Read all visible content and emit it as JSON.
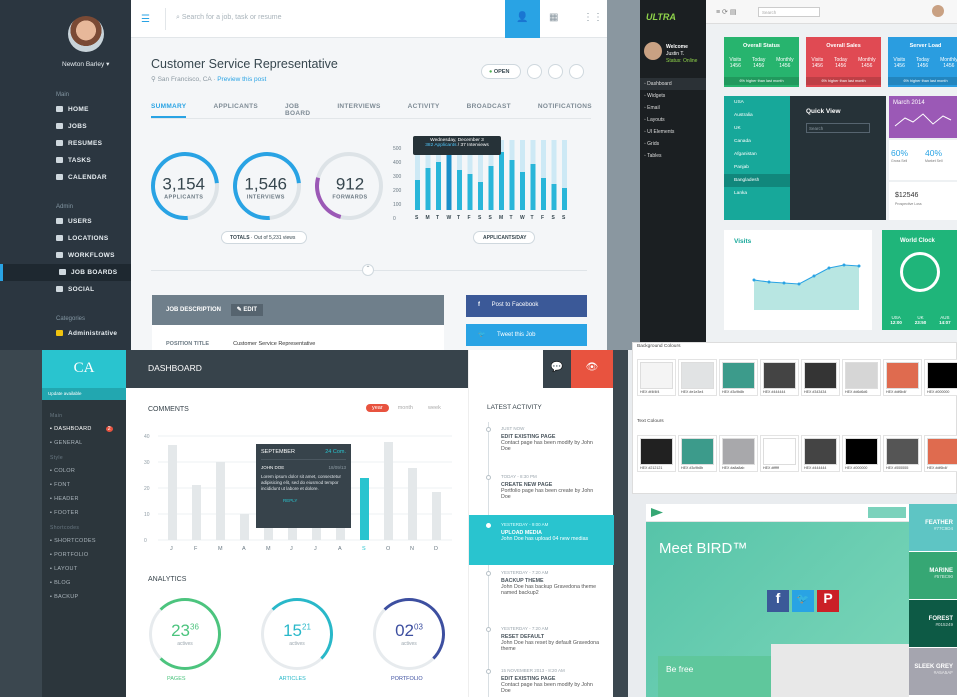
{
  "panel_a": {
    "user_name": "Newton Barley",
    "search_placeholder": "Search for a job, task or resume",
    "nav_main_header": "Main",
    "nav_main": [
      "HOME",
      "JOBS",
      "RESUMES",
      "TASKS",
      "CALENDAR"
    ],
    "nav_admin_header": "Admin",
    "nav_admin": [
      "USERS",
      "LOCATIONS",
      "WORKFLOWS",
      "JOB BOARDS",
      "SOCIAL"
    ],
    "nav_categories_header": "Categories",
    "nav_categories_first": "Administrative",
    "job_title": "Customer Service Representative",
    "location": "San Francisco, CA",
    "preview_link": "Preview this post",
    "status_label": "OPEN",
    "tabs": [
      "SUMMARY",
      "APPLICANTS",
      "JOB BOARD",
      "INTERVIEWS",
      "ACTIVITY",
      "BROADCAST",
      "NOTIFICATIONS"
    ],
    "stats": [
      {
        "value": "3,154",
        "label": "APPLICANTS"
      },
      {
        "value": "1,546",
        "label": "INTERVIEWS"
      },
      {
        "value": "912",
        "label": "FORWARDS"
      }
    ],
    "totals_label": "TOTALS",
    "totals_sub": "Out of 5,231 views",
    "chart_pill": "APPLICANTS/DAY",
    "tooltip_title": "Wednesday, December 3",
    "tooltip_apps": "382 Applicants",
    "tooltip_interviews": "37 Interviews",
    "job_desc_label": "JOB DESCRIPTION",
    "edit_label": "EDIT",
    "position_title_label": "POSITION TITLE",
    "position_title_value": "Customer Service Representative",
    "facebook_label": "Post to Facebook",
    "twitter_label": "Tweet this Job",
    "accent": "#29a3e4"
  },
  "panel_b": {
    "brand": "ULTRA",
    "search_placeholder": "Search",
    "welcome": "Welcome",
    "user": "Justin T.",
    "user_status": "Status: Online",
    "nav": [
      "Dashboard",
      "Widgets",
      "Email",
      "Layouts",
      "UI Elements",
      "Grids",
      "Tables"
    ],
    "tiles": [
      {
        "title": "Overall Status",
        "color": "#27b46e"
      },
      {
        "title": "Overall Sales",
        "color": "#e04a53"
      },
      {
        "title": "Server Load",
        "color": "#2a9de0"
      }
    ],
    "tile_cols": [
      "Visits",
      "Today",
      "Monthly"
    ],
    "tile_val": "1456",
    "tile_foot": "6% higher than last month",
    "countries": [
      "USA",
      "Australia",
      "UK",
      "Canada",
      "Afganistan",
      "Panjab",
      "Bangladesh",
      "Lanka"
    ],
    "quick_view": "Quick View",
    "quick_search": "Search",
    "month_label": "March 2014",
    "pct1": "60%",
    "pct1_label": "Gross Sell",
    "pct2": "40%",
    "pct2_label": "Market Sell",
    "amount": "$12546",
    "amount_label": "Prospective Loss",
    "visits_title": "Visits",
    "world_clock": "World Clock",
    "clocks": [
      {
        "city": "USA",
        "time": "12:00"
      },
      {
        "city": "UK",
        "time": "23:50"
      },
      {
        "city": "AUS",
        "time": "14:07"
      }
    ]
  },
  "panel_c": {
    "logo": "CA",
    "update": "Update available",
    "page_title": "DASHBOARD",
    "nav_sections": [
      {
        "header": "Main",
        "items": [
          "DASHBOARD",
          "GENERAL"
        ]
      },
      {
        "header": "Style",
        "items": [
          "COLOR",
          "FONT",
          "HEADER",
          "FOOTER"
        ]
      },
      {
        "header": "Shortcodes",
        "items": [
          "SHORTCODES",
          "PORTFOLIO",
          "LAYOUT",
          "BLOG",
          "BACKUP"
        ]
      }
    ],
    "dashboard_badge": "2",
    "comments_title": "COMMENTS",
    "periods": [
      "year",
      "month",
      "week"
    ],
    "months": [
      "J",
      "F",
      "M",
      "A",
      "M",
      "J",
      "J",
      "A",
      "S",
      "O",
      "N",
      "D"
    ],
    "y_ticks": [
      "40",
      "30",
      "20",
      "10",
      "0"
    ],
    "tooltip_month": "SEPTEMBER",
    "tooltip_count": "24 Com.",
    "tooltip_author": "JOHN DOE",
    "tooltip_date": "18/09/13",
    "tooltip_text": "Lorem ipsum dolor sit amet, consectetur adipisicing elit, sed do eiusmod tempor incididunt ut labore et dolore.",
    "tooltip_reply": "REPLY",
    "analytics_title": "ANALYTICS",
    "rings": [
      {
        "value": "23",
        "total": "36",
        "unit": "actives",
        "label": "PAGES",
        "color": "#4cc47e"
      },
      {
        "value": "15",
        "total": "21",
        "unit": "actives",
        "label": "ARTICLES",
        "color": "#29b8c9"
      },
      {
        "value": "02",
        "total": "03",
        "unit": "actives",
        "label": "PORTFOLIO",
        "color": "#3d4fa0"
      }
    ],
    "activity_title": "LATEST ACTIVITY",
    "events": [
      {
        "time": "JUST NOW",
        "title": "EDIT EXISTING PAGE",
        "text": "Contact page has been modify by John Doe"
      },
      {
        "time": "TODAY - 8:30 PM",
        "title": "CREATE NEW PAGE",
        "text": "Portfolio page has been create by John Doe"
      },
      {
        "time": "YESTERDAY - 9:00 AM",
        "title": "UPLOAD MEDIA",
        "text": "John Doe has upload 04 new medias"
      },
      {
        "time": "YESTERDAY - 7:20 AM",
        "title": "BACKUP THEME",
        "text": "John Doe has backup Gravedona theme named backup2"
      },
      {
        "time": "YESTERDAY - 7:20 AM",
        "title": "RESET DEFAULT",
        "text": "John Doe has reset by default Gravedona theme"
      },
      {
        "time": "15 NOVEMBER 2013 - 8:20 AM",
        "title": "EDIT EXISTING PAGE",
        "text": "Contact page has been modify by John Doe"
      }
    ],
    "accent": "#29c4cf",
    "red": "#e8533f"
  },
  "panel_d": {
    "bg_title": "Background Colours",
    "text_title": "Text Colours",
    "bg_swatches": [
      {
        "hex": "#f4f4f4",
        "label": "HEX #f4f4f4"
      },
      {
        "hex": "#e1e3e4",
        "label": "HEX #e1e3e4"
      },
      {
        "hex": "#3c9b8b",
        "label": "HEX #3c9b8b"
      },
      {
        "hex": "#444444",
        "label": "HEX #444444"
      },
      {
        "hex": "#343434",
        "label": "HEX #343434"
      },
      {
        "hex": "#d6d6d6",
        "label": "HEX #d6d6d6"
      },
      {
        "hex": "#df6b4f",
        "label": "HEX #df6b4f"
      },
      {
        "hex": "#000000",
        "label": "HEX #000000"
      }
    ],
    "text_swatches": [
      {
        "hex": "#212121",
        "label": "HEX #212121"
      },
      {
        "hex": "#3c9b8b",
        "label": "HEX #3c9b8b"
      },
      {
        "hex": "#a8a8ab",
        "label": "HEX #a8a8ab"
      },
      {
        "hex": "#ffffff",
        "label": "HEX #ffffff"
      },
      {
        "hex": "#444444",
        "label": "HEX #444444"
      },
      {
        "hex": "#000000",
        "label": "HEX #000000"
      },
      {
        "hex": "#555555",
        "label": "HEX #555555"
      },
      {
        "hex": "#df6b4f",
        "label": "HEX #df6b4f"
      }
    ]
  },
  "panel_e": {
    "hero": "Meet BIRD™",
    "be_free": "Be free",
    "colors": [
      {
        "name": "FEATHER",
        "hex": "#77C9D4",
        "bg": "#5ec5c4"
      },
      {
        "name": "MARINE",
        "hex": "#57BC90",
        "bg": "#36a774"
      },
      {
        "name": "FOREST",
        "hex": "#015249",
        "bg": "#0d5a45"
      },
      {
        "name": "SLEEK GREY",
        "hex": "#A5A5AF",
        "bg": "#a5a5af"
      }
    ]
  }
}
